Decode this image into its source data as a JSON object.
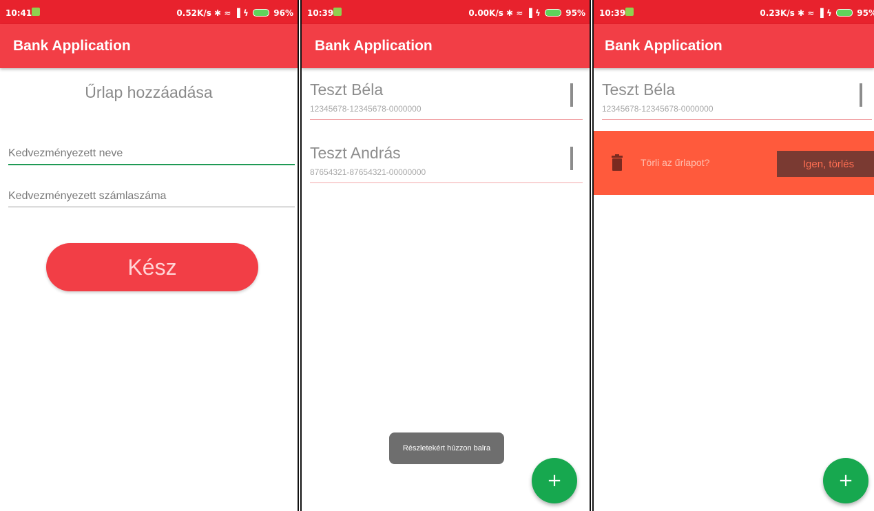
{
  "screens": [
    {
      "status": {
        "time": "10:41",
        "network_speed": "0.52K/s",
        "battery_percent": "96%"
      },
      "app_title": "Bank Application",
      "form": {
        "title": "Űrlap hozzáadása",
        "name_placeholder": "Kedvezményezett neve",
        "account_placeholder": "Kedvezményezett számlaszáma",
        "submit_label": "Kész"
      }
    },
    {
      "status": {
        "time": "10:39",
        "network_speed": "0.00K/s",
        "battery_percent": "95%"
      },
      "app_title": "Bank Application",
      "list": [
        {
          "name": "Teszt Béla",
          "account": "12345678-12345678-0000000"
        },
        {
          "name": "Teszt András",
          "account": "87654321-87654321-00000000"
        }
      ],
      "toast": "Részletekért húzzon balra",
      "fab_label": "+"
    },
    {
      "status": {
        "time": "10:39",
        "network_speed": "0.23K/s",
        "battery_percent": "95%"
      },
      "app_title": "Bank Application",
      "list": [
        {
          "name": "Teszt Béla",
          "account": "12345678-12345678-0000000"
        }
      ],
      "delete_prompt": {
        "question": "Törli az űrlapot?",
        "confirm_label": "Igen, törlés"
      },
      "fab_label": "+"
    }
  ],
  "colors": {
    "status_bar": "#e8222d",
    "app_bar": "#f23e46",
    "fab": "#17a84f",
    "delete_panel": "#ff5a3c"
  },
  "icons": [
    "bluetooth-icon",
    "wifi-icon",
    "signal-icon",
    "charging-icon",
    "battery-icon",
    "trash-icon",
    "plus-icon"
  ]
}
